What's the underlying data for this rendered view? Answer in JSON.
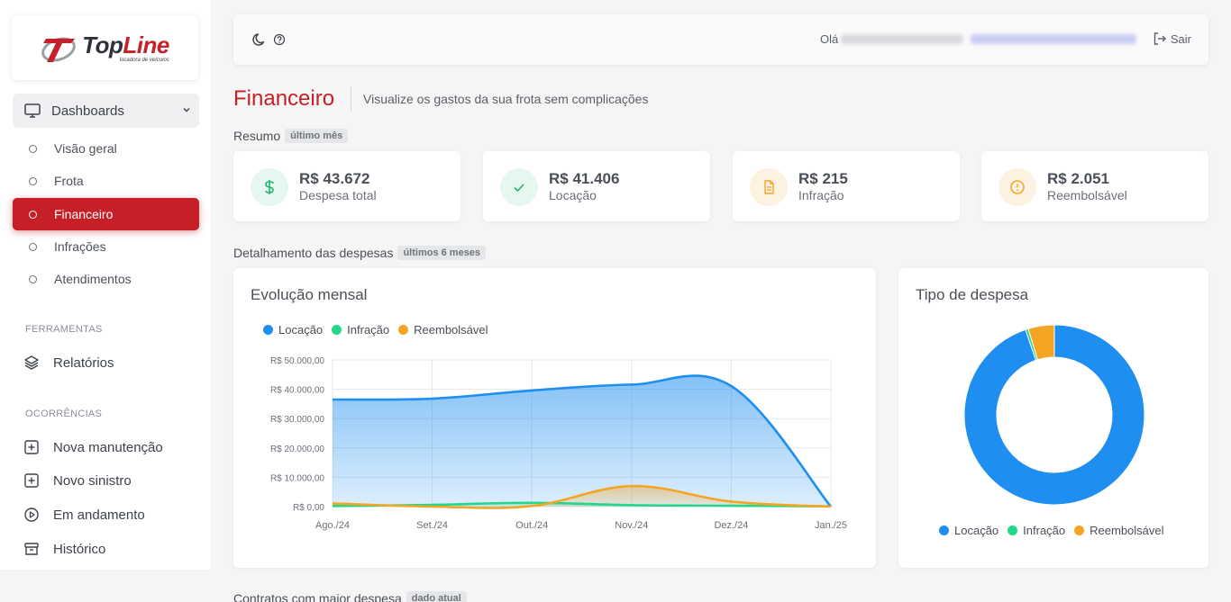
{
  "brand": {
    "logo_main": "Top",
    "logo_accent": "Line",
    "logo_tagline": "locadora de veículos"
  },
  "sidebar": {
    "group_label": "Dashboards",
    "sub_items": [
      "Visão geral",
      "Frota",
      "Financeiro",
      "Infrações",
      "Atendimentos"
    ],
    "active_item": "Financeiro",
    "tools_label": "FERRAMENTAS",
    "tools": [
      "Relatórios"
    ],
    "occurrences_label": "OCORRÊNCIAS",
    "occurrences": [
      "Nova manutenção",
      "Novo sinistro",
      "Em andamento",
      "Histórico"
    ]
  },
  "header": {
    "greeting": "Olá",
    "logout_label": "Sair"
  },
  "page": {
    "title": "Financeiro",
    "subtitle": "Visualize os gastos da sua frota sem complicações",
    "summary_label": "Resumo",
    "summary_badge": "último mês",
    "detail_label": "Detalhamento das despesas",
    "detail_badge": "últimos 6 meses",
    "contracts_label": "Contratos com maior despesa",
    "contracts_badge": "dado atual"
  },
  "cards": [
    {
      "value": "R$ 43.672",
      "label": "Despesa total",
      "icon": "dollar-icon",
      "color": "#22b573",
      "bg": "#e6f7ef"
    },
    {
      "value": "R$ 41.406",
      "label": "Locação",
      "icon": "check-icon",
      "color": "#22b573",
      "bg": "#e6f7ef"
    },
    {
      "value": "R$ 215",
      "label": "Infração",
      "icon": "document-icon",
      "color": "#f5a524",
      "bg": "#fdf1e1"
    },
    {
      "value": "R$ 2.051",
      "label": "Reembolsável",
      "icon": "alert-circle-icon",
      "color": "#f5a524",
      "bg": "#fdf1e1"
    }
  ],
  "chart_data": [
    {
      "type": "area",
      "title": "Evolução mensal",
      "categories": [
        "Ago./24",
        "Set./24",
        "Out./24",
        "Nov./24",
        "Dez./24",
        "Jan./25"
      ],
      "series": [
        {
          "name": "Locação",
          "color": "#1e8ff0",
          "values": [
            36500,
            36800,
            39600,
            41600,
            41100,
            0
          ]
        },
        {
          "name": "Infração",
          "color": "#22d68a",
          "values": [
            200,
            600,
            1300,
            500,
            300,
            100
          ]
        },
        {
          "name": "Reembolsável",
          "color": "#f5a524",
          "values": [
            1100,
            0,
            200,
            7000,
            1700,
            0
          ]
        }
      ],
      "yticks": [
        "R$ 0,00",
        "R$ 10.000,00",
        "R$ 20.000,00",
        "R$ 30.000,00",
        "R$ 40.000,00",
        "R$ 50.000,00"
      ],
      "ylim": [
        0,
        50000
      ],
      "legend_position": "top-left",
      "grid": true
    },
    {
      "type": "pie",
      "title": "Tipo de despesa",
      "labels": [
        "Locação",
        "Infração",
        "Reembolsável"
      ],
      "values": [
        41406,
        215,
        2051
      ],
      "colors": [
        "#1e8ff0",
        "#22d68a",
        "#f5a524"
      ],
      "donut": true,
      "legend_position": "bottom"
    }
  ]
}
